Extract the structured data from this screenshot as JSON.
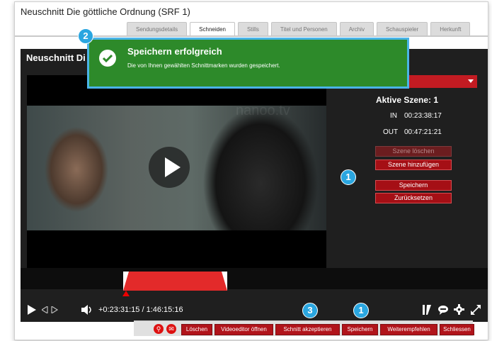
{
  "window": {
    "title": "Neuschnitt Die göttliche Ordnung (SRF 1)"
  },
  "tabs": [
    "Sendungsdetails",
    "Schneiden",
    "Stills",
    "Titel und Personen",
    "Archiv",
    "Schauspieler",
    "Herkunft"
  ],
  "active_tab": "Schneiden",
  "editor": {
    "title": "Neuschnitt Di",
    "watermark": "nanoo.tv",
    "scene": {
      "title": "Aktive Szene: 1",
      "in_label": "IN",
      "in_value": "00:23:38:17",
      "out_label": "OUT",
      "out_value": "00:47:21:21"
    },
    "buttons": {
      "delete_scene": "Szene löschen",
      "add_scene": "Szene hinzufügen",
      "save": "Speichern",
      "reset": "Zurücksetzen"
    },
    "player": {
      "position": "+0:23:31:15",
      "duration": "/ 1:46:15:16"
    },
    "selection": {
      "start_fraction": 0.22,
      "end_fraction": 0.45
    }
  },
  "toast": {
    "title": "Speichern erfolgreich",
    "message": "Die von Ihnen gewählten Schnittmarken wurden gespeichert."
  },
  "footer": {
    "buttons": [
      "Löschen",
      "Videoeditor öffnen",
      "Schnitt akzeptieren",
      "Speichern",
      "Weiterempfehlen",
      "Schliessen"
    ]
  },
  "badges": [
    "1",
    "2",
    "3",
    "1"
  ],
  "colors": {
    "accent": "#b1141b",
    "success": "#2d8a2a",
    "badge": "#2aa6e0"
  }
}
